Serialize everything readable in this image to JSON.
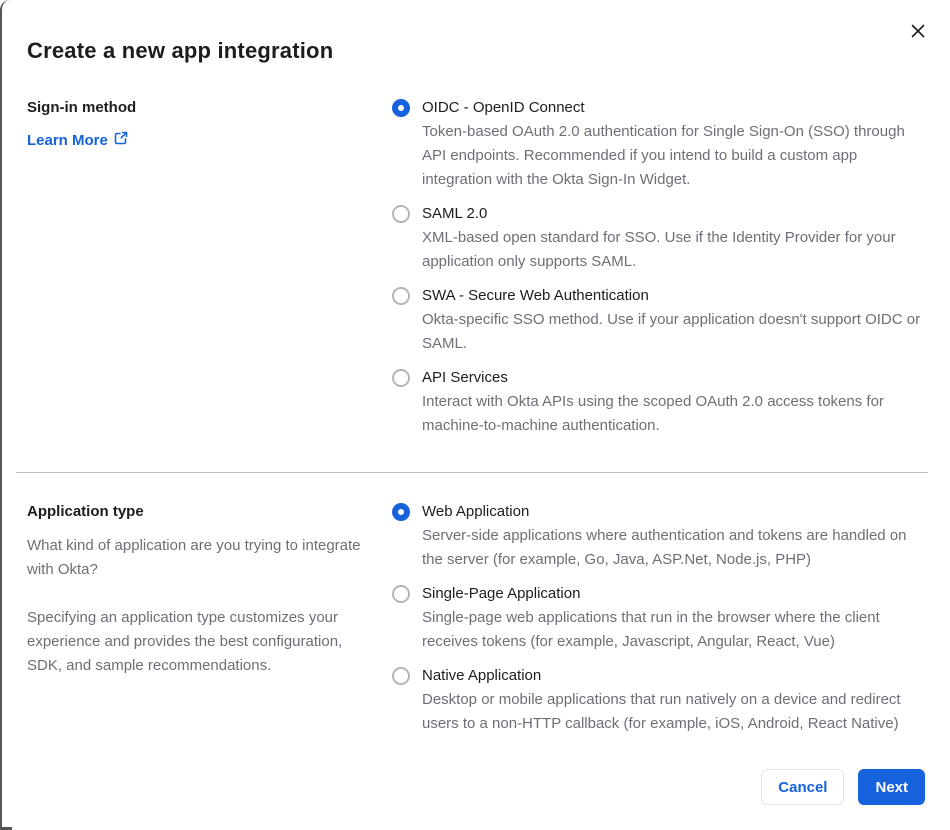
{
  "dialog": {
    "title": "Create a new app integration"
  },
  "sections": [
    {
      "heading": "Sign-in method",
      "learn_more": {
        "label": "Learn More"
      },
      "options": [
        {
          "label": "OIDC - OpenID Connect",
          "description": "Token-based OAuth 2.0 authentication for Single Sign-On (SSO) through API endpoints. Recommended if you intend to build a custom app integration with the Okta Sign-In Widget.",
          "selected": true
        },
        {
          "label": "SAML 2.0",
          "description": "XML-based open standard for SSO. Use if the Identity Provider for your application only supports SAML.",
          "selected": false
        },
        {
          "label": "SWA - Secure Web Authentication",
          "description": "Okta-specific SSO method. Use if your application doesn't support OIDC or SAML.",
          "selected": false
        },
        {
          "label": "API Services",
          "description": "Interact with Okta APIs using the scoped OAuth 2.0 access tokens for machine-to-machine authentication.",
          "selected": false
        }
      ]
    },
    {
      "heading": "Application type",
      "paragraphs": [
        "What kind of application are you trying to integrate with Okta?",
        "Specifying an application type customizes your experience and provides the best configuration, SDK, and sample recommendations."
      ],
      "options": [
        {
          "label": "Web Application",
          "description": "Server-side applications where authentication and tokens are handled on the server (for example, Go, Java, ASP.Net, Node.js, PHP)",
          "selected": true
        },
        {
          "label": "Single-Page Application",
          "description": "Single-page web applications that run in the browser where the client receives tokens (for example, Javascript, Angular, React, Vue)",
          "selected": false
        },
        {
          "label": "Native Application",
          "description": "Desktop or mobile applications that run natively on a device and redirect users to a non-HTTP callback (for example, iOS, Android, React Native)",
          "selected": false
        }
      ]
    }
  ],
  "footer": {
    "cancel_label": "Cancel",
    "next_label": "Next"
  },
  "colors": {
    "accent_blue": "#1662dd",
    "text_dark": "#1d1d21",
    "text_gray": "#6e6e78",
    "divider_gray": "#bcbcc3",
    "radio_border_gray": "#b5b5bc"
  }
}
